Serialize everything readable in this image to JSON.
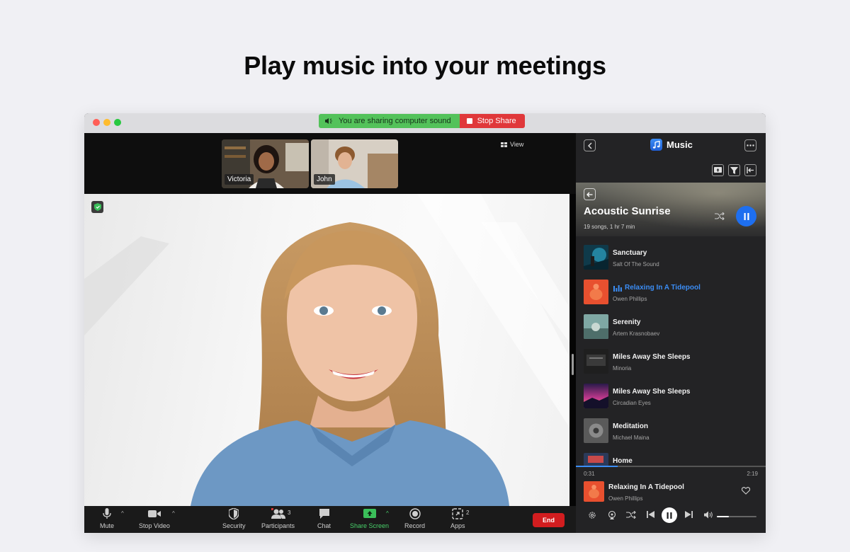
{
  "headline": "Play music into your meetings",
  "window": {
    "sharing": {
      "status": "You are sharing computer sound",
      "stop_label": "Stop Share"
    },
    "traffic_colors": [
      "#ff5f57",
      "#febc2e",
      "#28c840"
    ]
  },
  "meeting": {
    "view_label": "View",
    "participants": [
      {
        "name": "Victoria"
      },
      {
        "name": "John"
      }
    ],
    "toolbar": {
      "mute": "Mute",
      "stop_video": "Stop Video",
      "security": "Security",
      "participants": "Participants",
      "participants_count": "3",
      "chat": "Chat",
      "share_screen": "Share Screen",
      "record": "Record",
      "apps": "Apps",
      "apps_count": "2",
      "end": "End"
    }
  },
  "music": {
    "header_title": "Music",
    "playlist": {
      "title": "Acoustic Sunrise",
      "meta": "19 songs, 1 hr 7 min"
    },
    "songs": [
      {
        "title": "Sanctuary",
        "artist": "Salt Of The Sound"
      },
      {
        "title": "Relaxing In A Tidepool",
        "artist": "Owen Phillips",
        "playing": true
      },
      {
        "title": "Serenity",
        "artist": "Artem Krasnobaev"
      },
      {
        "title": "Miles Away She Sleeps",
        "artist": "Minoria"
      },
      {
        "title": "Miles Away She Sleeps",
        "artist": "Circadian Eyes"
      },
      {
        "title": "Meditation",
        "artist": "Michael Maina"
      },
      {
        "title": "Home",
        "artist": ""
      }
    ],
    "now_playing": {
      "title": "Relaxing In A Tidepool",
      "artist": "Owen Phillips",
      "elapsed": "0:31",
      "duration": "2:19",
      "progress": 0.22,
      "volume": 0.3
    },
    "accent": "#1e6ff0"
  }
}
